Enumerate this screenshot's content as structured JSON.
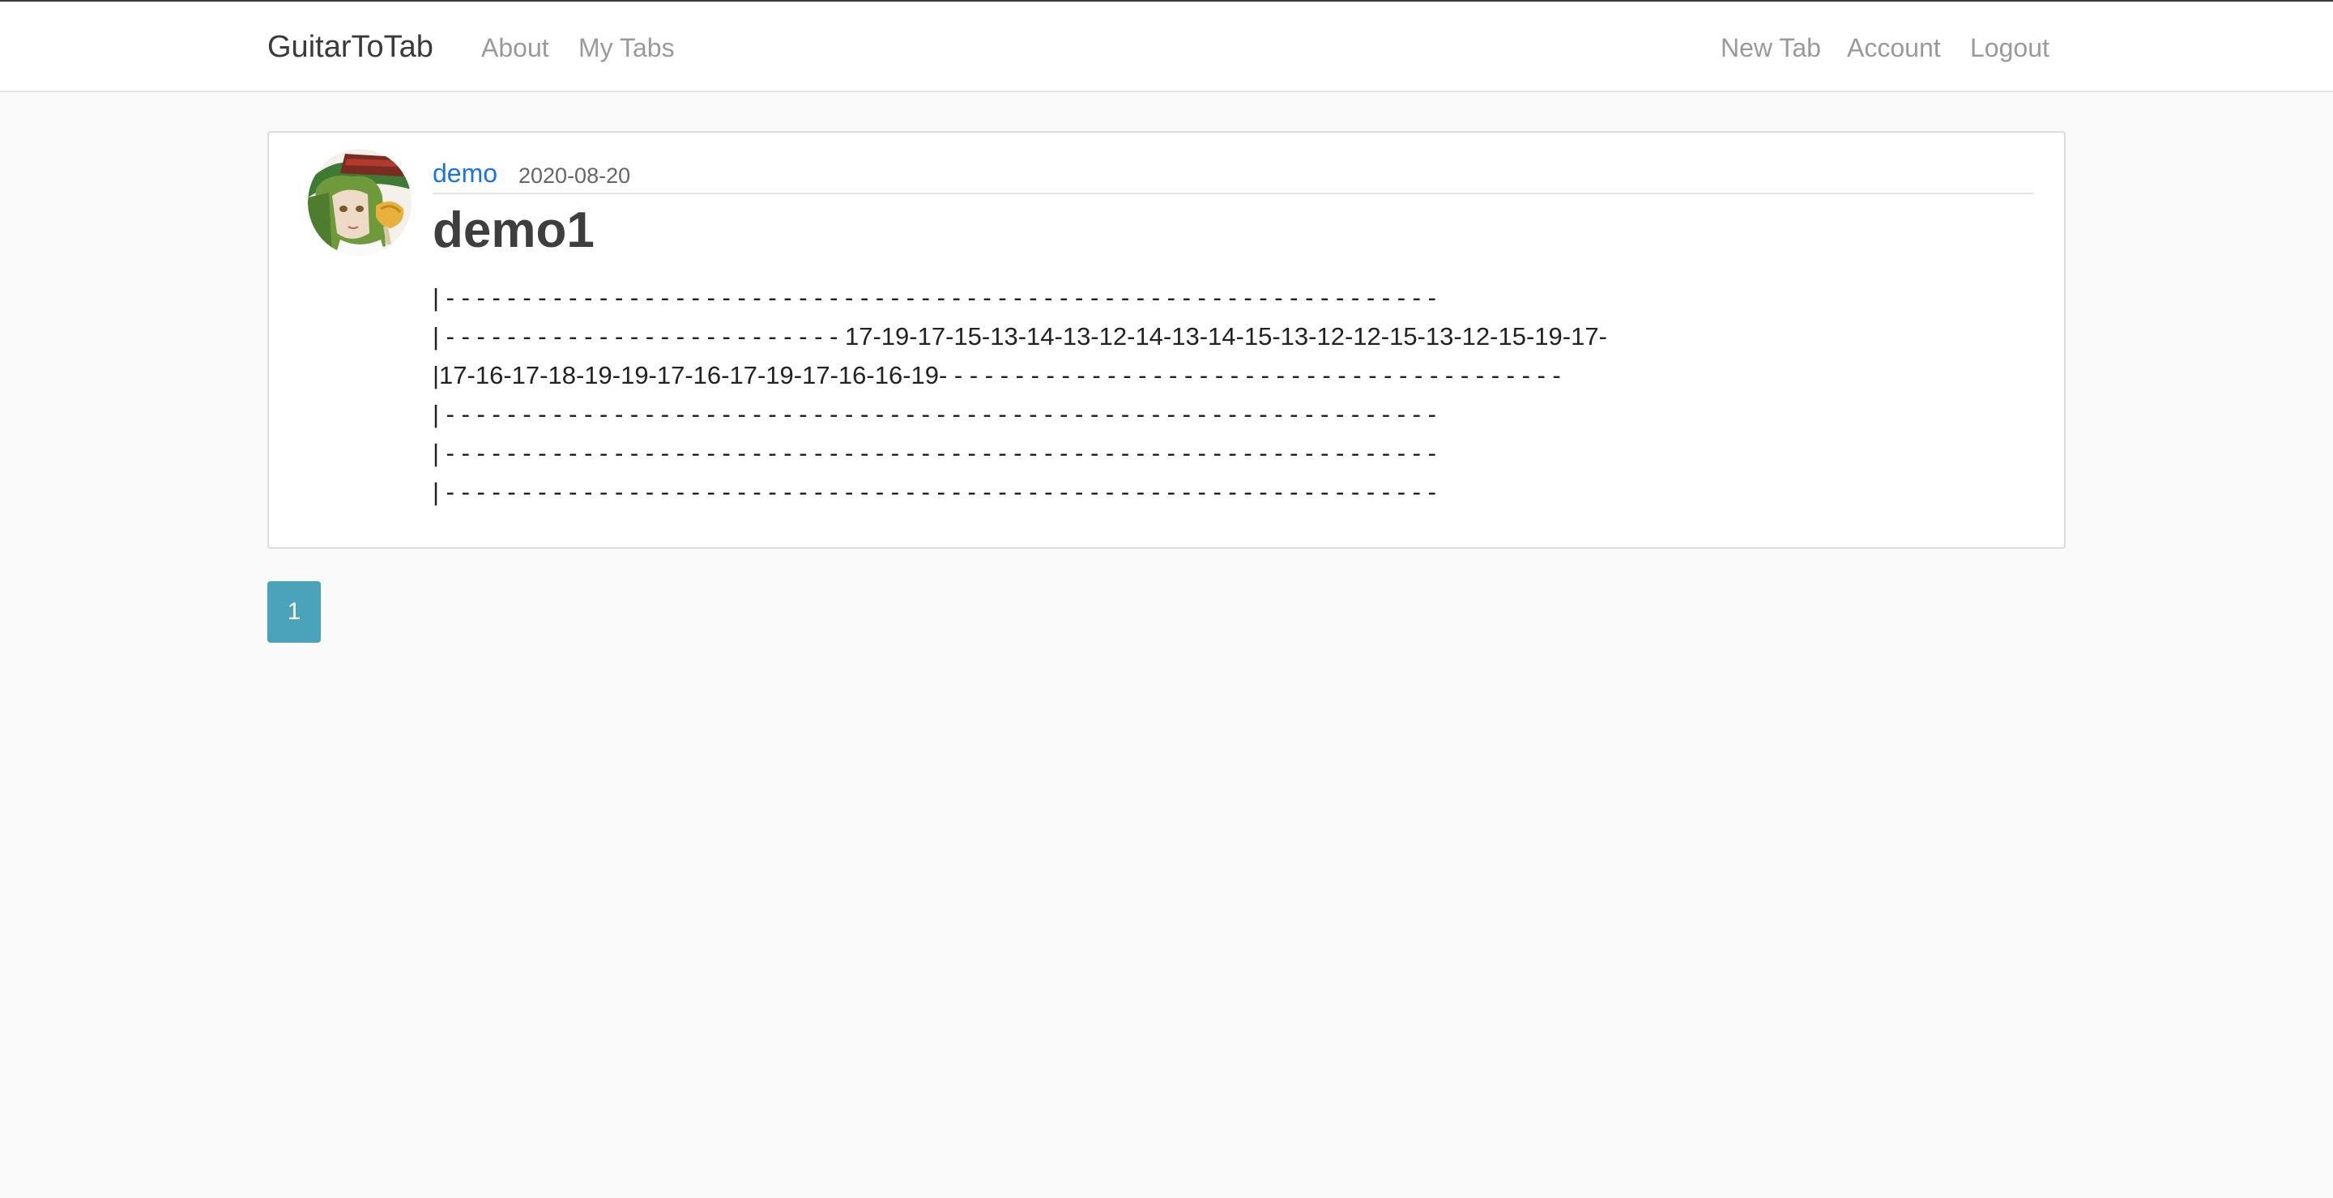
{
  "navbar": {
    "brand": "GuitarToTab",
    "left_links": [
      "About",
      "My Tabs"
    ],
    "right_links": [
      "New Tab",
      "Account",
      "Logout"
    ]
  },
  "post": {
    "author": "demo",
    "date": "2020-08-20",
    "title": "demo1",
    "tab_lines": [
      "| - - - - - - - - - - - - - - - - - - - - - - - - - - - - - - - - - - - - - - - - - - - - - - - - - - - - - - - - - - - - - - - - -",
      "| - - - - - - - - - - - - - - - - - - - - - - - - - - 17-19-17-15-13-14-13-12-14-13-14-15-13-12-12-15-13-12-15-19-17-",
      "|17-16-17-18-19-19-17-16-17-19-17-16-16-19- - - - - - - - - - - - - - - - - - - - - - - - - - - - - - - - - - - - - - - - -",
      "| - - - - - - - - - - - - - - - - - - - - - - - - - - - - - - - - - - - - - - - - - - - - - - - - - - - - - - - - - - - - - - - - -",
      "| - - - - - - - - - - - - - - - - - - - - - - - - - - - - - - - - - - - - - - - - - - - - - - - - - - - - - - - - - - - - - - - - -",
      "| - - - - - - - - - - - - - - - - - - - - - - - - - - - - - - - - - - - - - - - - - - - - - - - - - - - - - - - - - - - - - - - - -"
    ]
  },
  "pagination": {
    "current_page": "1"
  }
}
